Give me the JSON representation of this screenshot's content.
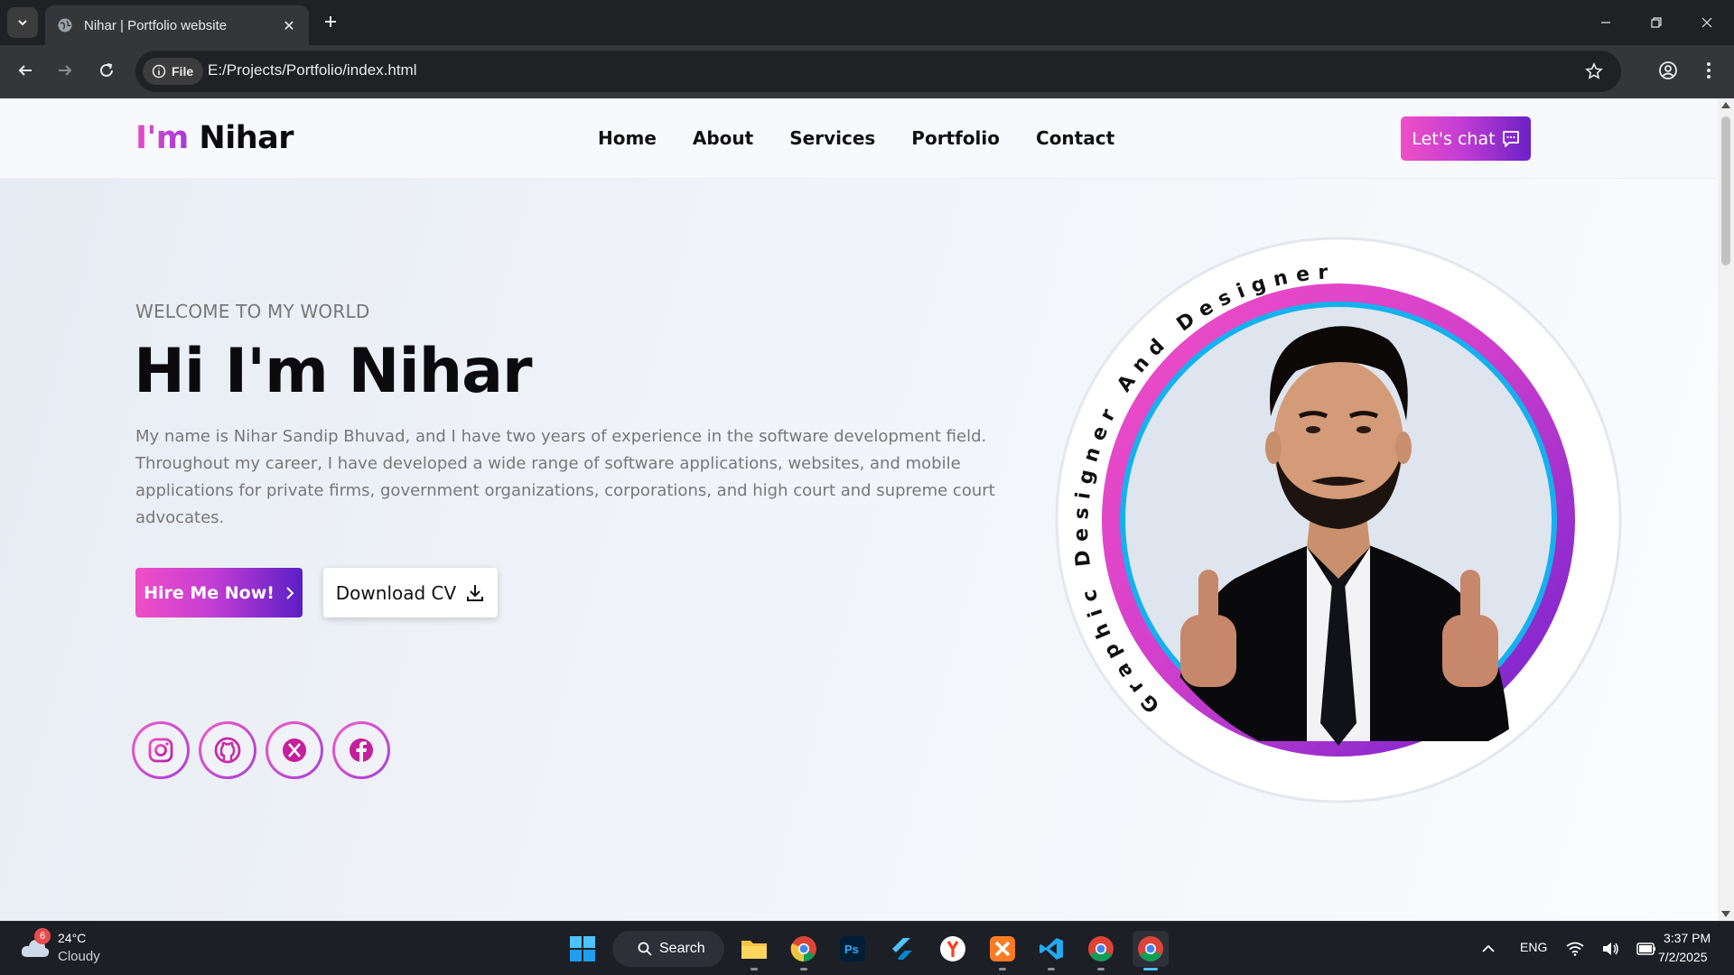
{
  "browser": {
    "tab_title": "Nihar | Portfolio website",
    "file_chip": "File",
    "url": "E:/Projects/Portfolio/index.html"
  },
  "site": {
    "logo_prefix": "I'm",
    "logo_name": "Nihar",
    "nav": [
      "Home",
      "About",
      "Services",
      "Portfolio",
      "Contact"
    ],
    "chat_button": "Let's chat",
    "welcome": "WELCOME TO MY WORLD",
    "hero_title": "Hi I'm Nihar",
    "hero_description": "My name is Nihar Sandip Bhuvad, and I have two years of experience in the software development field. Throughout my career, I have developed a wide range of software applications, websites, and mobile applications for private firms, government organizations, corporations, and high court and supreme court advocates.",
    "hire_button": "Hire Me Now!",
    "cv_button": "Download CV",
    "ring_text": "Graphic Designer And Designer",
    "social": [
      "instagram-icon",
      "github-icon",
      "x-icon",
      "facebook-icon"
    ],
    "accent_pink": "#ef4fc6",
    "accent_purple": "#6b21c7"
  },
  "taskbar": {
    "weather_badge": "6",
    "temperature": "24°C",
    "condition": "Cloudy",
    "search_label": "Search",
    "language": "ENG",
    "time": "3:37 PM",
    "date": "7/2/2025"
  }
}
